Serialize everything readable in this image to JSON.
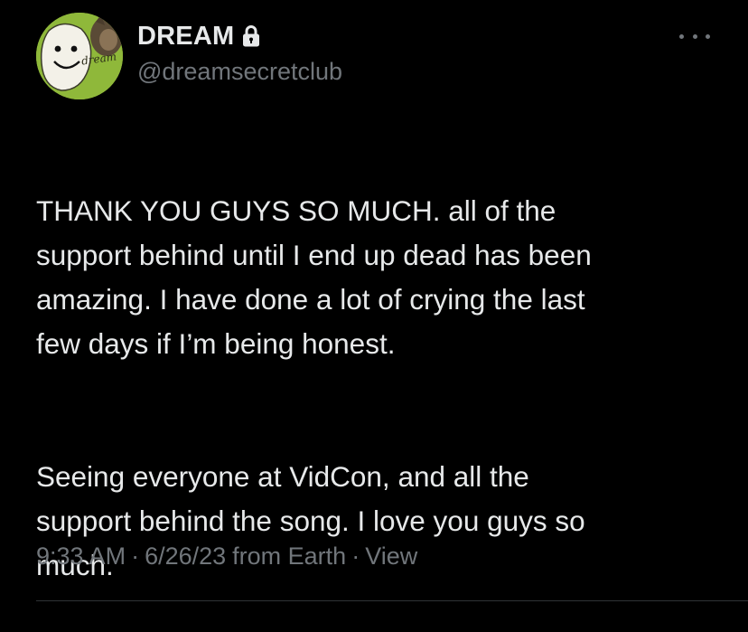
{
  "tweet": {
    "author": {
      "display_name": "DREAM",
      "handle": "@dreamsecretclub",
      "protected_icon": "lock-icon",
      "avatar_text": "dream"
    },
    "more_icon": "more-horizontal-icon",
    "paragraphs": [
      "THANK YOU GUYS SO MUCH. all of the\nsupport behind until I end up dead has been\namazing. I have done a lot of crying the last\nfew days if I’m being honest.",
      "Seeing everyone at VidCon, and all the\nsupport behind the song. I love you guys so\nmuch."
    ],
    "meta": {
      "time": "9:33 AM",
      "date": "6/26/23",
      "source": "from Earth",
      "separator": "·",
      "view_label": "View"
    }
  },
  "colors": {
    "background": "#000000",
    "text_primary": "#e7e9ea",
    "text_secondary": "#71767b",
    "avatar_green": "#8fb83a"
  }
}
